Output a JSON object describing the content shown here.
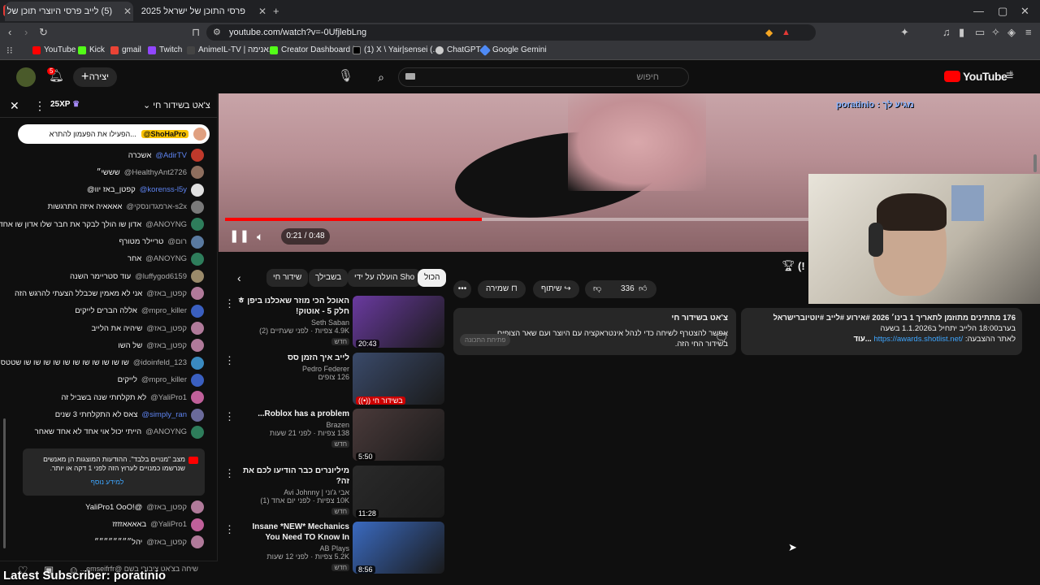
{
  "browser": {
    "tabs": [
      {
        "title": "(5) לייב פרסי היוצרי תוכן של",
        "active": true
      },
      {
        "title": "פרסי התוכן של ישראל 2025 | הצבעין",
        "active": false
      }
    ],
    "url": "youtube.com/watch?v=-0UfjlebLng",
    "bookmarks": [
      "YouTube",
      "Kick",
      "gmail",
      "Twitch",
      "AnimeIL-TV | אנימה...",
      "Creator Dashboard |...",
      "(1) X \\ Yair|sensei (...",
      "ChatGPT",
      "Google Gemini"
    ]
  },
  "yt_header": {
    "search_placeholder": "חיפוש",
    "create_label": "יצירה",
    "notif_count": "5",
    "logo_text": "YouTube",
    "logo_sup": "IL"
  },
  "chat": {
    "title": "צ'אט בשידור חי",
    "xp": "25XP",
    "pinned_user": "@ShoHaPro",
    "pinned_text": "הפעילו את הפעמון להתרא...",
    "messages": [
      {
        "user": "@AdirTV",
        "text": "אשכרה",
        "blue": true,
        "color": "#c0392b"
      },
      {
        "user": "@HealthyAnt2726",
        "text": "שששי״",
        "blue": false,
        "color": "#8e6e5e"
      },
      {
        "user": "@korenss-l5y",
        "text": "@קפטן_באז יוו",
        "blue": true,
        "color": "#e0e0e0"
      },
      {
        "user": "@ארמגדונסקי-s2x",
        "text": "אאאאיה איזה התרגשות",
        "blue": false,
        "color": "#7a7a7a"
      },
      {
        "user": "@ANOYNG",
        "text": "אדון שו הולך לבקר את חבר שלו אדון שו אחד",
        "blue": false,
        "color": "#2e7d5b"
      },
      {
        "user": "@רום",
        "text": "טריילר מטורף",
        "blue": false,
        "color": "#5a7aa0"
      },
      {
        "user": "@ANOYNG",
        "text": "אחר",
        "blue": false,
        "color": "#2e7d5b"
      },
      {
        "user": "@luffygod6159",
        "text": "עוד סטריימר השנה",
        "blue": false,
        "color": "#9a8a6a"
      },
      {
        "user": "@קפטן_באז",
        "text": "אני לא מאמין שכבלל הצעתי להרגש הזה",
        "blue": false,
        "color": "#b07a9a"
      },
      {
        "user": "@mpro_killer",
        "text": "אללה הברים לייקים",
        "blue": false,
        "color": "#3a5fc0"
      },
      {
        "user": "@קפטן_באז",
        "text": "שיהיה את הלייב",
        "blue": false,
        "color": "#b07a9a"
      },
      {
        "user": "@קפטן_באז",
        "text": "של השו",
        "blue": false,
        "color": "#b07a9a"
      },
      {
        "user": "@idoinfeld_123",
        "text": "שו שו שו שו שו שו שו שו שו שו שו שטטס",
        "blue": false,
        "color": "#3a8ac0"
      },
      {
        "user": "@mpro_killer",
        "text": "לייקים",
        "blue": false,
        "color": "#3a5fc0"
      },
      {
        "user": "@YaliPro1",
        "text": "לא תקלחתי שנה בשביל זה",
        "blue": false,
        "color": "#c0609a"
      },
      {
        "user": "@simply_ran",
        "text": "צאס לא התקלחתי 3 שנים",
        "blue": true,
        "color": "#6a6a9a"
      },
      {
        "user": "@ANOYNG",
        "text": "הייתי יכול אוי אחד לא אחד שאחר",
        "blue": false,
        "color": "#2e7d5b"
      }
    ],
    "notice_text": "מצב \"מנויים בלבד\". ההודעות המוצגות הן מאנשים שנרשמו כמנויים לערוץ הזה לפני 1 דקה או יותר.",
    "notice_link": "למידע נוסף",
    "messages2": [
      {
        "user": "@קפטן_באז",
        "text": "YaliPro1 OoO!@",
        "color": "#b07a9a"
      },
      {
        "user": "@YaliPro1",
        "text": "באאאאזזזז",
        "color": "#c0609a"
      },
      {
        "user": "@קפטן_באז",
        "text": "יהל״״״״״״״״",
        "color": "#b07a9a"
      }
    ],
    "input_placeholder": "שיחה בצ'אט ציבורי בשם @emseifrfr...",
    "latest_subscriber": "Latest Subscriber: poratinio"
  },
  "player": {
    "overlay_text": "מגיע לך : poratinio",
    "time": "0:21 / 0:48",
    "progress": 0.44
  },
  "video": {
    "title_fragment": "(!",
    "likes": "336",
    "share_label": "שיתוף",
    "save_label": "שמירה"
  },
  "chips": [
    "הכול",
    "הועלה על ידי Sho",
    "בשבילך",
    "שידור חי"
  ],
  "recommendations": [
    {
      "title": "האוכל הכי מוזר שאכלנו ביפן ㅎ חלק 5 - אוטוק!",
      "channel": "Seth Saban",
      "stats": "4.9K צפיות · לפני שעתיים (2)",
      "badge": "חדש",
      "duration": "20:43",
      "thumb": "#6a3aa0"
    },
    {
      "title": "לייב איך הזמן סס",
      "channel": "Pedro Federer",
      "stats": "126 צופים",
      "badge": "",
      "duration": "((•)) בשידור חי",
      "thumb": "#3a4a6a"
    },
    {
      "title": "Roblox has a problem...",
      "channel": "Brazen",
      "stats": "138 צפיות · לפני 21 שעות",
      "badge": "חדש",
      "duration": "5:50",
      "thumb": "#4a3a3a"
    },
    {
      "title": "מיליונרים כבר הודיעו לכם את זה?",
      "channel": "אבי ג'וני | Avi Johnny",
      "stats": "10K צפיות · לפני יום אחד (1)",
      "badge": "חדש",
      "duration": "11:28",
      "thumb": "#2a2a2a"
    },
    {
      "title": "Insane *NEW* Mechanics You Need TO Know In Universal ...",
      "channel": "AB Plays",
      "stats": "5.2K צפיות · לפני 12 שעות",
      "badge": "חדש",
      "duration": "8:56",
      "thumb": "#3a6ac0"
    }
  ],
  "description": {
    "stats_line": "176 מתתינים  מתוזמן לתאריך 1 בינו׳ 2026  #אירוע #לייב #יוטיוברישראל",
    "line2": "בערב18:00 הלייב יתחיל ב1.1.2026 בשעה",
    "link": "https://awards.shotlist.net/",
    "link_pre": "לאתר ההצבעה:",
    "more": "...עוד",
    "chat_box_title": "צ'אט בשידור חי",
    "chat_box_text": "אפשר להצטרף לשיחה כדי לנהל אינטראקציה עם היוצר ועם שאר הצופים בשידור החי הזה.",
    "chat_box_button": "פתיחת התכונה"
  }
}
